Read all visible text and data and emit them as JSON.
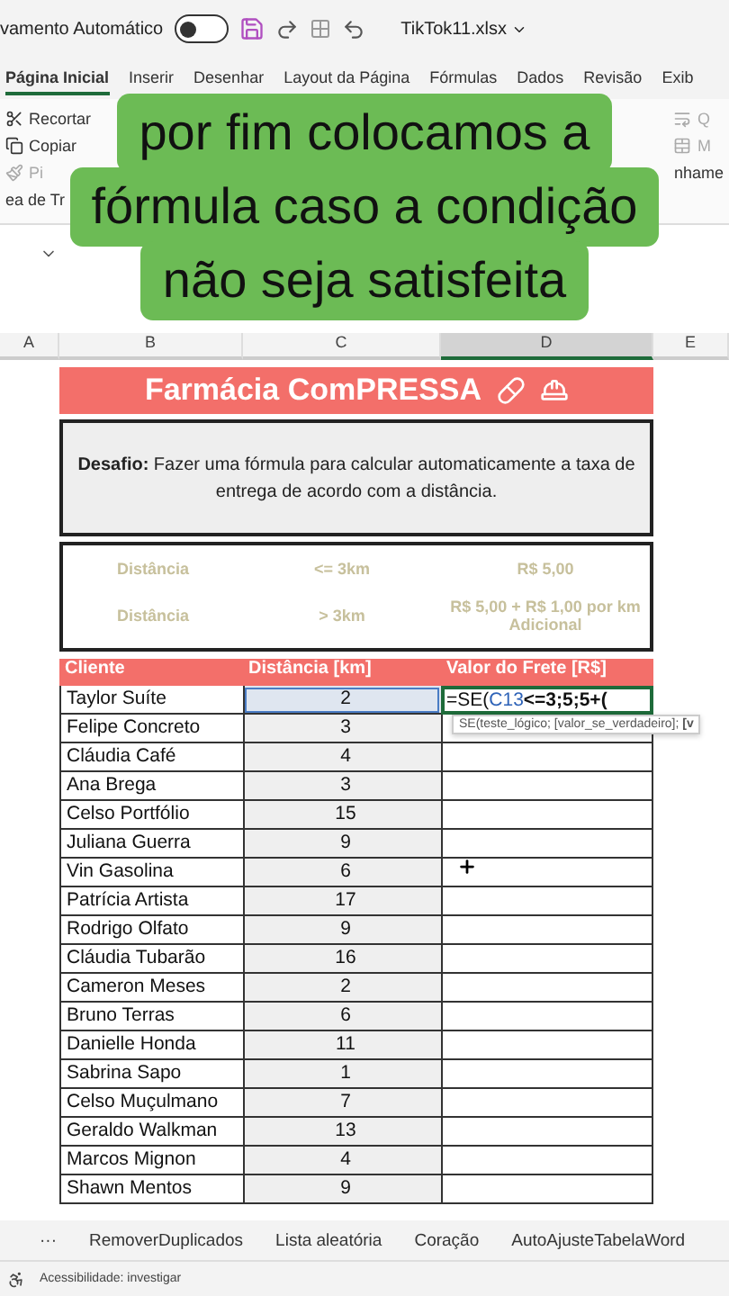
{
  "titlebar": {
    "autosave_label": "vamento Automático",
    "autosave_on": false,
    "file_name": "TikTok11.xlsx"
  },
  "ribbon_tabs": [
    {
      "label": "Página Inicial",
      "selected": true
    },
    {
      "label": "Inserir",
      "selected": false
    },
    {
      "label": "Desenhar",
      "selected": false
    },
    {
      "label": "Layout da Página",
      "selected": false
    },
    {
      "label": "Fórmulas",
      "selected": false
    },
    {
      "label": "Dados",
      "selected": false
    },
    {
      "label": "Revisão",
      "selected": false
    },
    {
      "label": "Exib",
      "selected": false
    }
  ],
  "ribbon": {
    "clipboard": [
      {
        "kind": "cut",
        "label": "Recortar"
      },
      {
        "kind": "copy",
        "label": "Copiar"
      },
      {
        "kind": "paint",
        "label": "Pi"
      }
    ],
    "group_label": "ea de Tr",
    "right_items": [
      {
        "kind": "wrap",
        "label": "Q"
      },
      {
        "kind": "merge",
        "label": "M"
      }
    ],
    "right_group_label": "nhame"
  },
  "caption": {
    "lines": [
      "por fim colocamos a",
      "fórmula caso a condição",
      "não seja satisfeita"
    ]
  },
  "column_headers": [
    {
      "label": "A",
      "selected": false
    },
    {
      "label": "B",
      "selected": false
    },
    {
      "label": "C",
      "selected": false
    },
    {
      "label": "D",
      "selected": true
    },
    {
      "label": "E",
      "selected": false
    }
  ],
  "sheet": {
    "title": "Farmácia ComPRESSA",
    "challenge": "**Desafio:** Fazer uma fórmula para calcular automaticamente a taxa de entrega de acordo com a distância.",
    "rules": [
      {
        "label": "Distância",
        "condition": "<= 3km",
        "fee": "R$ 5,00"
      },
      {
        "label": "Distância",
        "condition": "> 3km",
        "fee": "R$ 5,00 + R$ 1,00 por km Adicional"
      }
    ],
    "table": {
      "columns": [
        "Cliente",
        "Distância [km]",
        "Valor do Frete [R$]"
      ],
      "formula": [
        {
          "kind": "plain",
          "text": "=SE("
        },
        {
          "kind": "ref",
          "text": "C13"
        },
        {
          "kind": "op",
          "text": "<=3;5;5+("
        }
      ],
      "hint": "SE(teste_lógico; [valor_se_verdadeiro]; **[v**",
      "rows": [
        {
          "client": "Taylor Suíte",
          "distance": "2",
          "editing": true
        },
        {
          "client": "Felipe Concreto",
          "distance": "3",
          "editing": false
        },
        {
          "client": "Cláudia Café",
          "distance": "4",
          "editing": false
        },
        {
          "client": "Ana Brega",
          "distance": "3",
          "editing": false
        },
        {
          "client": "Celso Portfólio",
          "distance": "15",
          "editing": false
        },
        {
          "client": "Juliana Guerra",
          "distance": "9",
          "editing": false
        },
        {
          "client": "Vin Gasolina",
          "distance": "6",
          "editing": false
        },
        {
          "client": "Patrícia Artista",
          "distance": "17",
          "editing": false
        },
        {
          "client": "Rodrigo Olfato",
          "distance": "9",
          "editing": false
        },
        {
          "client": "Cláudia Tubarão",
          "distance": "16",
          "editing": false
        },
        {
          "client": "Cameron Meses",
          "distance": "2",
          "editing": false
        },
        {
          "client": "Bruno Terras",
          "distance": "6",
          "editing": false
        },
        {
          "client": "Danielle Honda",
          "distance": "11",
          "editing": false
        },
        {
          "client": "Sabrina Sapo",
          "distance": "1",
          "editing": false
        },
        {
          "client": "Celso Muçulmano",
          "distance": "7",
          "editing": false
        },
        {
          "client": "Geraldo Walkman",
          "distance": "13",
          "editing": false
        },
        {
          "client": "Marcos Mignon",
          "distance": "4",
          "editing": false
        },
        {
          "client": "Shawn Mentos",
          "distance": "9",
          "editing": false
        }
      ]
    }
  },
  "sheet_tabs": {
    "more": "···",
    "tabs": [
      "RemoverDuplicados",
      "Lista aleatória",
      "Coração",
      "AutoAjusteTabelaWord"
    ]
  },
  "status_bar": {
    "accessibility": "Acessibilidade: investigar"
  }
}
